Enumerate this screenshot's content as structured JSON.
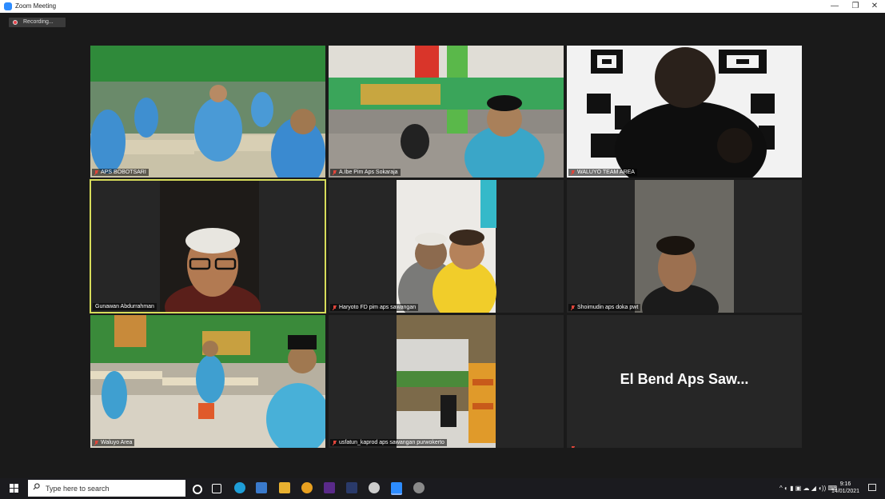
{
  "window": {
    "title": "Zoom Meeting",
    "minimize": "—",
    "restore": "❐",
    "close": "✕"
  },
  "recording": {
    "label": "Recording..."
  },
  "participants": [
    {
      "name": "APS BOBOTSARI",
      "muted": true
    },
    {
      "name": "A.Ibe Pim Aps Sokaraja",
      "muted": true
    },
    {
      "name": "WALUYO TEAM AREA",
      "muted": true
    },
    {
      "name": "Gunawan Abdurrahman",
      "muted": false,
      "active": true
    },
    {
      "name": "Haryoto FD pim aps sawangan",
      "muted": true
    },
    {
      "name": "Shoimudin aps doka pwt",
      "muted": true
    },
    {
      "name": "Waluyo Area",
      "muted": true
    },
    {
      "name": "usfatun_kaprod aps sawangan purwokerto",
      "muted": true
    },
    {
      "name": "",
      "muted": true,
      "display_text": "El Bend Aps Saw..."
    }
  ],
  "taskbar": {
    "search_placeholder": "Type here to search",
    "time": "9:16",
    "date": "14/01/2021"
  },
  "colors": {
    "active_speaker": "#d7dc5a",
    "recording_dot": "#e8434b",
    "mute": "#e0453a"
  }
}
